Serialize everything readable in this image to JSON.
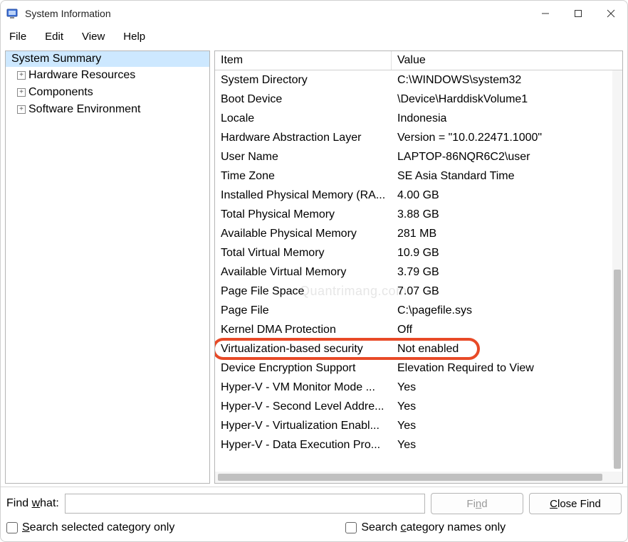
{
  "window": {
    "title": "System Information"
  },
  "menubar": [
    "File",
    "Edit",
    "View",
    "Help"
  ],
  "tree": {
    "root": "System Summary",
    "children": [
      "Hardware Resources",
      "Components",
      "Software Environment"
    ]
  },
  "list": {
    "columns": {
      "item": "Item",
      "value": "Value"
    },
    "rows": [
      {
        "item": "System Directory",
        "value": "C:\\WINDOWS\\system32"
      },
      {
        "item": "Boot Device",
        "value": "\\Device\\HarddiskVolume1"
      },
      {
        "item": "Locale",
        "value": "Indonesia"
      },
      {
        "item": "Hardware Abstraction Layer",
        "value": "Version = \"10.0.22471.1000\""
      },
      {
        "item": "User Name",
        "value": "LAPTOP-86NQR6C2\\user"
      },
      {
        "item": "Time Zone",
        "value": "SE Asia Standard Time"
      },
      {
        "item": "Installed Physical Memory (RA...",
        "value": "4.00 GB"
      },
      {
        "item": "Total Physical Memory",
        "value": "3.88 GB"
      },
      {
        "item": "Available Physical Memory",
        "value": "281 MB"
      },
      {
        "item": "Total Virtual Memory",
        "value": "10.9 GB"
      },
      {
        "item": "Available Virtual Memory",
        "value": "3.79 GB"
      },
      {
        "item": "Page File Space",
        "value": "7.07 GB"
      },
      {
        "item": "Page File",
        "value": "C:\\pagefile.sys"
      },
      {
        "item": "Kernel DMA Protection",
        "value": "Off"
      },
      {
        "item": "Virtualization-based security",
        "value": "Not enabled",
        "highlight": true
      },
      {
        "item": "Device Encryption Support",
        "value": "Elevation Required to View"
      },
      {
        "item": "Hyper-V - VM Monitor Mode ...",
        "value": "Yes"
      },
      {
        "item": "Hyper-V - Second Level Addre...",
        "value": "Yes"
      },
      {
        "item": "Hyper-V - Virtualization Enabl...",
        "value": "Yes"
      },
      {
        "item": "Hyper-V - Data Execution Pro...",
        "value": "Yes"
      }
    ]
  },
  "find": {
    "label_prefix": "Find ",
    "label_ul": "w",
    "label_suffix": "hat:",
    "value": "",
    "find_btn_ul": "n",
    "find_btn_prefix": "Fi",
    "find_btn_suffix": "d",
    "close_btn_ul": "C",
    "close_btn_suffix": "lose Find"
  },
  "checks": {
    "selected_prefix": "",
    "selected_ul": "S",
    "selected_suffix": "earch selected category only",
    "catnames_prefix": "Search ",
    "catnames_ul": "c",
    "catnames_suffix": "ategory names only"
  },
  "watermark": "Quantrimang.com"
}
